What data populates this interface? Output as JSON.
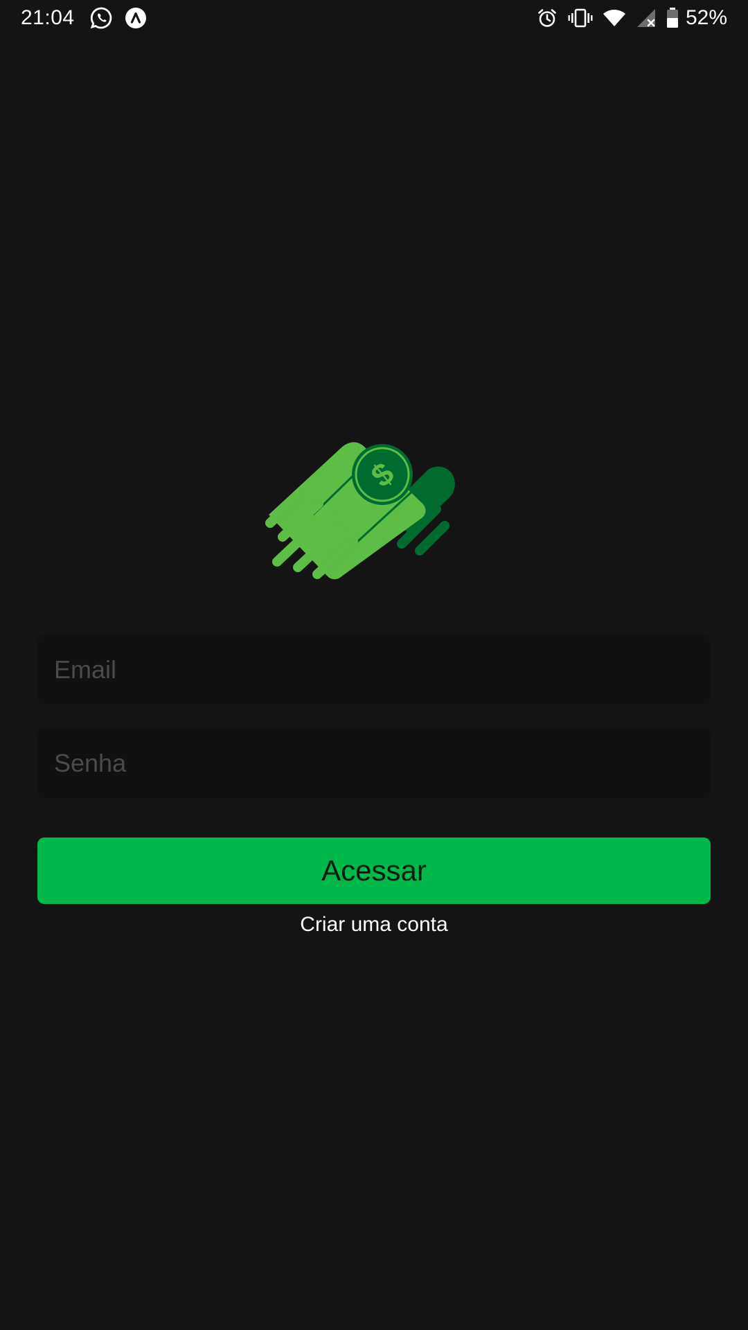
{
  "status_bar": {
    "time": "21:04",
    "left_icons": [
      "whatsapp-icon",
      "app-notification-icon"
    ],
    "right_icons": [
      "alarm-icon",
      "vibrate-icon",
      "wifi-icon",
      "signal-no-service-icon",
      "battery-icon"
    ],
    "battery": "52%"
  },
  "logo": {
    "icon": "flying-money-icon",
    "colors": {
      "light_green": "#5dbd47",
      "dark_green": "#006b2e",
      "mid_green": "#1a8a3a"
    }
  },
  "form": {
    "email_placeholder": "Email",
    "password_placeholder": "Senha",
    "submit_label": "Acessar",
    "create_account_label": "Criar uma conta"
  },
  "colors": {
    "background": "#141414",
    "field_background": "#111111",
    "accent": "#00b94a"
  }
}
